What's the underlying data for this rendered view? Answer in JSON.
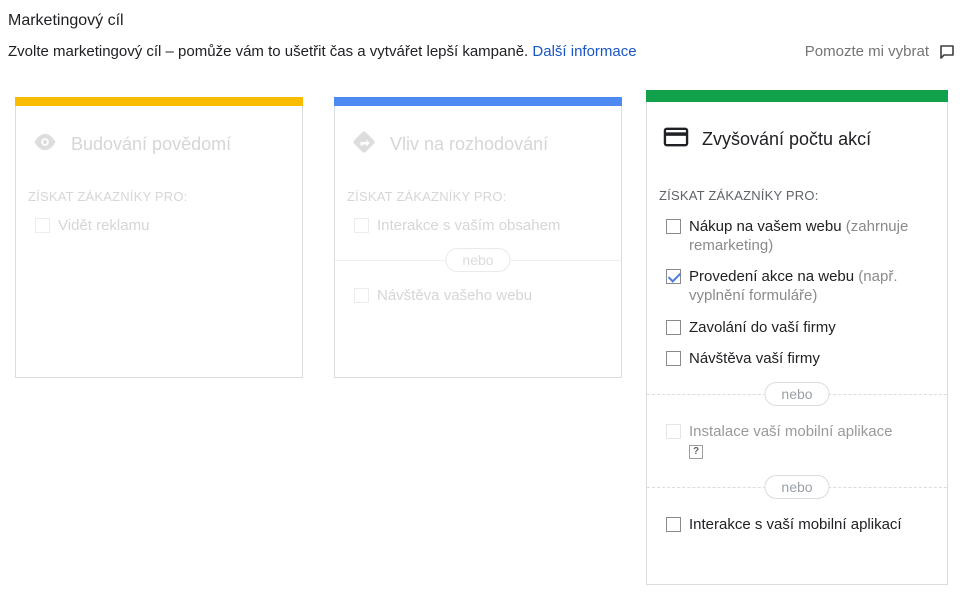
{
  "header": {
    "title": "Marketingový cíl",
    "subtitle": "Zvolte marketingový cíl – pomůže vám to ušetřit čas a vytvářet lepší kampaně.",
    "more_link": "Další informace",
    "help_label": "Pomozte mi vybrat",
    "help_icon": "feedback-icon"
  },
  "cards": [
    {
      "title": "Budování povědomí",
      "icon": "eye-icon",
      "accent": "#f9bc00",
      "section_label": "ZÍSKAT ZÁKAZNÍKY PRO:",
      "options": [
        "Vidět reklamu"
      ]
    },
    {
      "title": "Vliv na rozhodování",
      "icon": "directions-icon",
      "accent": "#4e8af2",
      "section_label": "ZÍSKAT ZÁKAZNÍKY PRO:",
      "options": [
        "Interakce s vaším obsahem",
        "Návštěva vašeho webu"
      ],
      "separator": "nebo"
    },
    {
      "title": "Zvyšování počtu akcí",
      "icon": "credit-card-icon",
      "accent": "#11a14a",
      "section_label": "ZÍSKAT ZÁKAZNÍKY PRO:",
      "options": [
        {
          "label": "Nákup na vašem webu",
          "note": "(zahrnuje remarketing)",
          "checked": false
        },
        {
          "label": "Provedení akce na webu",
          "note": "(např. vyplnění formuláře)",
          "checked": true
        },
        {
          "label": "Zavolání do vaší firmy",
          "checked": false
        },
        {
          "label": "Návštěva vaší firmy",
          "checked": false
        },
        {
          "label": "Instalace vaší mobilní aplikace",
          "checked": false,
          "disabled": true,
          "help": "?"
        },
        {
          "label": "Interakce s vaší mobilní aplikací",
          "checked": false
        }
      ],
      "separator": "nebo"
    }
  ]
}
